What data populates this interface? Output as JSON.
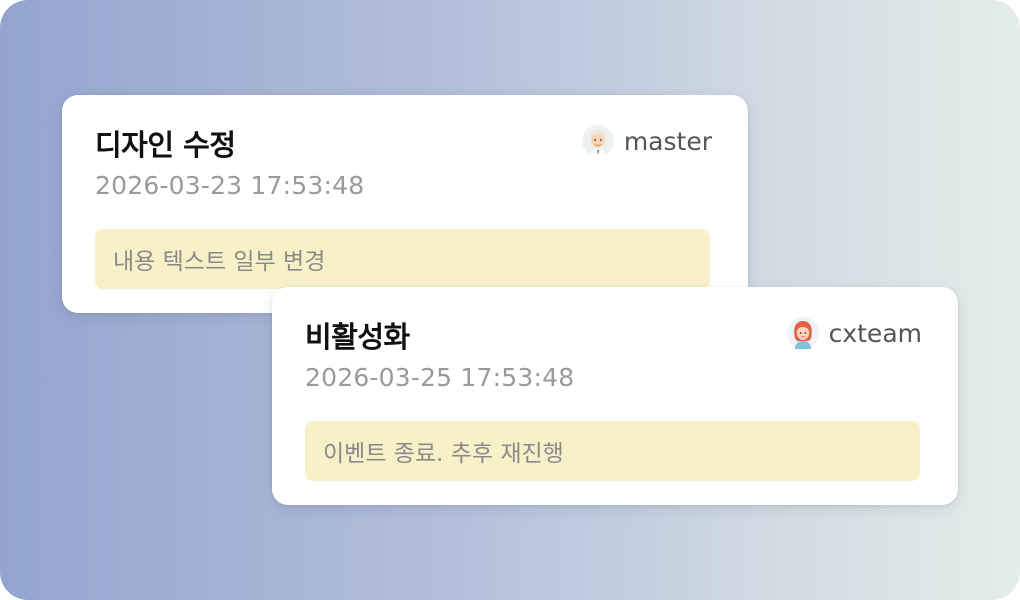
{
  "cards": [
    {
      "title": "디자인 수정",
      "timestamp": "2026-03-23 17:53:48",
      "author": {
        "name": "master",
        "avatar_icon": "avatar-elderly-icon"
      },
      "note": "내용 텍스트 일부 변경"
    },
    {
      "title": "비활성화",
      "timestamp": "2026-03-25 17:53:48",
      "author": {
        "name": "cxteam",
        "avatar_icon": "avatar-redhair-icon"
      },
      "note": "이벤트 종료. 추후 재진행"
    }
  ],
  "colors": {
    "note_bg": "#f8f1c8",
    "title": "#111111",
    "timestamp": "#9a9a9a",
    "background_start": "#93a4cf",
    "background_end": "#e4ede8"
  }
}
